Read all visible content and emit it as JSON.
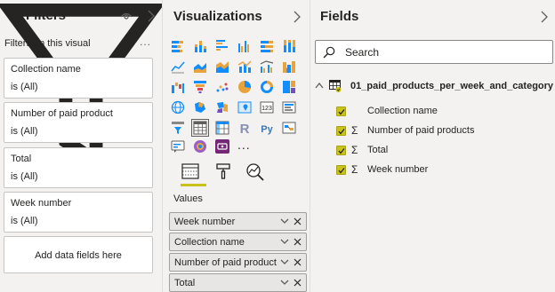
{
  "filters": {
    "title": "Filters",
    "subheading": "Filters on this visual",
    "more": "...",
    "cards": [
      {
        "name": "Collection name",
        "state": "is (All)"
      },
      {
        "name": "Number of paid product",
        "state": "is (All)"
      },
      {
        "name": "Total",
        "state": "is (All)"
      },
      {
        "name": "Week number",
        "state": "is (All)"
      }
    ],
    "add_label": "Add data fields here"
  },
  "visualizations": {
    "title": "Visualizations",
    "more_icons": "...",
    "values_label": "Values",
    "wells": [
      {
        "label": "Week number"
      },
      {
        "label": "Collection name"
      },
      {
        "label": "Number of paid products"
      },
      {
        "label": "Total"
      }
    ]
  },
  "fields": {
    "title": "Fields",
    "search_placeholder": "Search",
    "table_name": "01_paid_products_per_week_and_category",
    "items": [
      {
        "name": "Collection name",
        "sigma": ""
      },
      {
        "name": "Number of paid products",
        "sigma": "Σ"
      },
      {
        "name": "Total",
        "sigma": "Σ"
      },
      {
        "name": "Week number",
        "sigma": "Σ"
      }
    ]
  },
  "colors": {
    "accent": "#c8c21a",
    "pane_background": "#f3f2f1",
    "card_border": "#c8c6c4"
  }
}
